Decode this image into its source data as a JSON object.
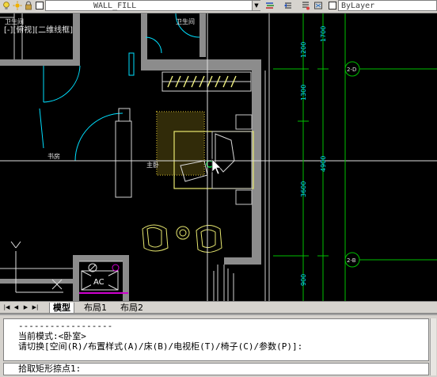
{
  "toolbar": {
    "layer_name": "WALL_FILL",
    "linetype": "ByLayer",
    "icons": [
      "lightbulb-icon",
      "sun-icon",
      "lock-icon",
      "color-swatch-icon",
      "layer-states-icon",
      "layer-previous-icon",
      "layer-match-icon",
      "color-control-icon"
    ]
  },
  "viewport": {
    "label": "[-][俯视][二维线框]"
  },
  "drawing": {
    "rooms": {
      "bathroom_left": "卫生间",
      "bathroom": "卫生间",
      "study": "书房",
      "master_bedroom": "主卧"
    },
    "dimensions_top": [
      "1200",
      "1700"
    ],
    "dimensions_mid": [
      "1300",
      "4900",
      "3600"
    ],
    "dimensions_low": "900",
    "axis_labels": [
      "2-D",
      "2-B"
    ],
    "ac_label": "AC",
    "colors": {
      "wall": "#8c8c8c",
      "dim": "#00c000",
      "cyan": "#00e0ff",
      "yellow": "#e8e870",
      "bed": "#c8c8c8",
      "grid": "#e0e0e0"
    }
  },
  "tabs": {
    "items": [
      "模型",
      "布局1",
      "布局2"
    ],
    "active": "模型"
  },
  "command": {
    "history": [
      "------------------",
      "当前模式:<卧室>",
      "请切换[空间(R)/布置样式(A)/床(B)/电视柜(T)/椅子(C)/参数(P)]:"
    ],
    "prompt": "拾取矩形捺点1:"
  }
}
